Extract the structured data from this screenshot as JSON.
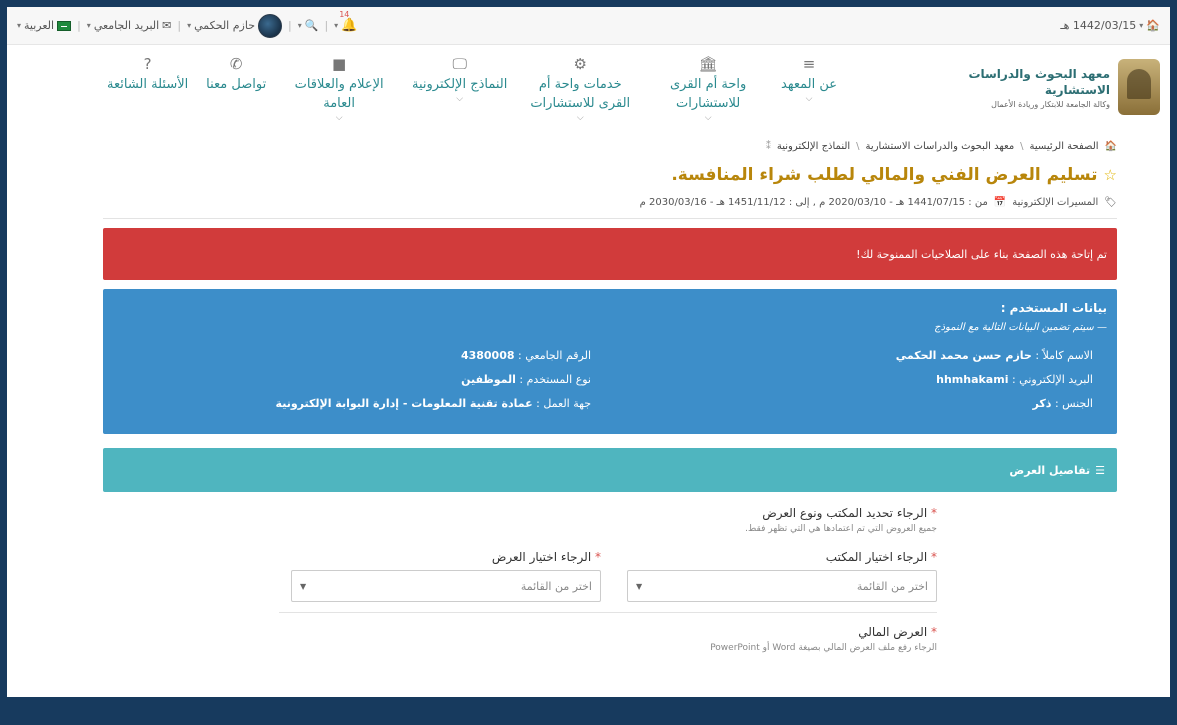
{
  "topbar": {
    "date": "1442/03/15 هـ",
    "language": "العربية",
    "university_email": "البريد الجامعي",
    "user_name": "حازم الحكمي",
    "notification_count": "14"
  },
  "institute": {
    "name": "معهد البحوث والدراسات الاستشارية",
    "subtitle": "وكالة الجامعة للابتكار وريادة الأعمال"
  },
  "nav": [
    {
      "label": "عن المعهد",
      "icon": "bars-icon",
      "glyph": "≡",
      "has_dropdown": true
    },
    {
      "label": "واحة أم القرى للاستشارات",
      "icon": "institution-icon",
      "glyph": "🏛",
      "has_dropdown": true
    },
    {
      "label": "خدمات واحة أم القرى للاستشارات",
      "icon": "gears-icon",
      "glyph": "⚙",
      "has_dropdown": true
    },
    {
      "label": "النماذج الإلكترونية",
      "icon": "desktop-icon",
      "glyph": "🖵",
      "has_dropdown": true
    },
    {
      "label": "الإعلام والعلاقات العامة",
      "icon": "video-camera-icon",
      "glyph": "■",
      "has_dropdown": true
    },
    {
      "label": "تواصل معنا",
      "icon": "phone-icon",
      "glyph": "✆",
      "has_dropdown": false
    },
    {
      "label": "الأسئلة الشائعة",
      "icon": "question-circle-icon",
      "glyph": "?",
      "has_dropdown": false
    }
  ],
  "breadcrumb": {
    "home": "الصفحة الرئيسية",
    "institute": "معهد البحوث والدراسات الاستشارية",
    "forms": "النماذج الإلكترونية"
  },
  "page": {
    "title": "تسليم العرض الفني والمالي لطلب شراء المنافسة.",
    "category": "المسيرات الإلكترونية",
    "date_range": "من : 1441/07/15 هـ - 2020/03/10 م , إلى : 1451/11/12 هـ - 2030/03/16 م"
  },
  "alert": {
    "text": "تم إتاحة هذه الصفحة بناء على الصلاحيات الممنوحة لك!"
  },
  "user_data": {
    "title": "بيانات المستخدم :",
    "note": "— سيتم تضمين البيانات التالية مع النموذج",
    "full_name_label": "الاسم كاملاً :",
    "full_name": "حازم حسن محمد الحكمي",
    "email_label": "البريد الإلكتروني :",
    "email": "hhmhakami",
    "gender_label": "الجنس :",
    "gender": "ذكر",
    "uni_id_label": "الرقم الجامعي :",
    "uni_id": "4380008",
    "user_type_label": "نوع المستخدم :",
    "user_type": "الموظفين",
    "workplace_label": "جهة العمل :",
    "workplace": "عمادة تقنية المعلومات - إدارة البوابة الإلكترونية"
  },
  "offer_details": {
    "heading": "تفاصيل العرض",
    "q1_label": "الرجاء تحديد المكتب ونوع العرض",
    "q1_help": "جميع العروض التي تم اعتمادها هي التي تظهر فقط.",
    "office_label": "الرجاء اختيار المكتب",
    "office_value": "اختر من القائمة",
    "offer_label": "الرجاء اختيار العرض",
    "offer_value": "اختر من القائمة",
    "financial_label": "العرض المالي",
    "financial_help": "الرجاء رفع ملف العرض المالي بصيغة Word أو PowerPoint"
  }
}
